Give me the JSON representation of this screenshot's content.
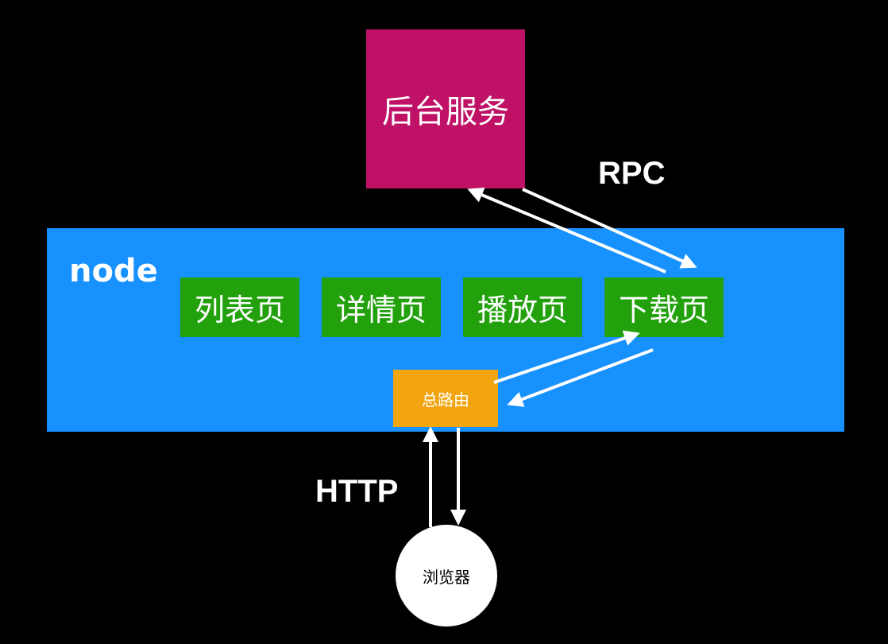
{
  "backend": {
    "label": "后台服务"
  },
  "node": {
    "label": "node",
    "pages": [
      "列表页",
      "详情页",
      "播放页",
      "下载页"
    ]
  },
  "router": {
    "label": "总路由"
  },
  "browser": {
    "label": "浏览器"
  },
  "protocols": {
    "rpc": "RPC",
    "http": "HTTP"
  },
  "colors": {
    "background": "#000000",
    "backend": "#bf1166",
    "node_panel": "#1691fe",
    "page": "#22a10d",
    "router": "#f2a50f",
    "browser": "#ffffff",
    "arrow": "#ffffff"
  }
}
